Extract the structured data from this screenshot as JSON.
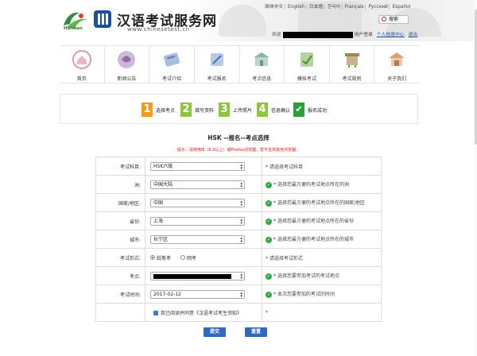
{
  "header": {
    "logo_text": "Hanban",
    "site_title": "汉语考试服务网",
    "site_url": "www.chinesetest.cn",
    "languages": [
      "简体中文",
      "English",
      "日本語",
      "한국어",
      "Français",
      "Русский",
      "Español"
    ],
    "search_label": "搜索",
    "welcome": "欢迎",
    "user_center_prefix": "用户登录",
    "user_center_link": "个人信息中心",
    "logout_link": "退出"
  },
  "nav": [
    {
      "label": "首页",
      "icon": "home-icon"
    },
    {
      "label": "新闻公告",
      "icon": "news-icon"
    },
    {
      "label": "考试介绍",
      "icon": "exam-intro-icon"
    },
    {
      "label": "考试报名",
      "icon": "exam-registration-icon"
    },
    {
      "label": "考点信息",
      "icon": "test-center-icon"
    },
    {
      "label": "模拟考试",
      "icon": "mock-exam-icon"
    },
    {
      "label": "考试规则",
      "icon": "exam-rules-icon"
    },
    {
      "label": "关于我们",
      "icon": "about-us-icon"
    }
  ],
  "steps": [
    {
      "num": "1",
      "label": "选择考点",
      "color": "#f39a1e"
    },
    {
      "num": "2",
      "label": "填写资料",
      "color": "#8cc63e"
    },
    {
      "num": "3",
      "label": "上传照片",
      "color": "#8cc63e"
    },
    {
      "num": "4",
      "label": "信息确认",
      "color": "#8cc63e"
    },
    {
      "num": "✔",
      "label": "报名成功",
      "color": "#2e9e3a"
    }
  ],
  "form": {
    "title": "HSK --报名--考点选择",
    "notice": "提示：请使用IE（6.0以上）或Firefox浏览器，暂不支持其他浏览器。",
    "rows": {
      "subject": {
        "label": "考试科目:",
        "value": "HSK六级",
        "hint": "请选择考试科目",
        "hint_type": "star"
      },
      "continent": {
        "label": "洲:",
        "value": "中国大陆",
        "hint": "选择您最方便的考试地点所在的洲",
        "hint_type": "check"
      },
      "country": {
        "label": "国家/地区:",
        "value": "中国",
        "hint": "选择您最方便的考试地点所在的国家/地区",
        "hint_type": "check"
      },
      "province": {
        "label": "省份:",
        "value": "上海",
        "hint": "选择您最方便的考试地点所在的省份",
        "hint_type": "check"
      },
      "city": {
        "label": "城市:",
        "value": "长宁区",
        "hint": "选择您最方便的考试地点所在的城市",
        "hint_type": "check"
      },
      "format": {
        "label": "考试形式:",
        "options": [
          "纸笔考",
          "网考"
        ],
        "selected": "纸笔考",
        "hint": "请选择考试形式",
        "hint_type": "star"
      },
      "center": {
        "label": "考点:",
        "value": "",
        "hint": "选择您要参加考试的考试地点",
        "hint_type": "check"
      },
      "date": {
        "label": "考试时间:",
        "value": "2017-02-12",
        "hint": "本次您要参加的考试的时间",
        "hint_type": "check"
      }
    },
    "agree": "我已阅读并同意《汉语考试考生须知》",
    "agree_star": "*",
    "submit": "提交",
    "reset": "重置"
  },
  "colors": {
    "accent": "#2f6ac0",
    "check": "#35a845",
    "notice": "#e02020"
  }
}
